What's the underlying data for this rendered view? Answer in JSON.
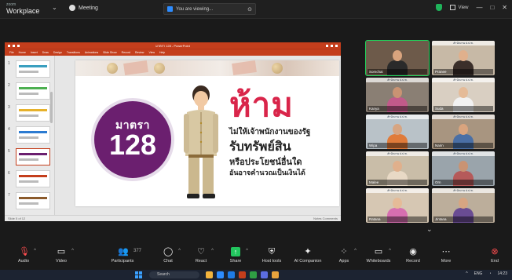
{
  "topbar": {
    "app_name": "Workplace",
    "app_sub": "zoom",
    "meeting_label": "Meeting",
    "share_label": "You are viewing...",
    "view_label": "View"
  },
  "slide": {
    "circle_label": "มาตรา",
    "circle_number": "128",
    "headline": "ห้าม",
    "line1": "ไม่ให้เจ้าพนักงานของรัฐ",
    "line2": "รับทรัพย์สิน",
    "line3": "หรือประโยชน์อื่นใด",
    "line4": "อันอาจคำนวณเป็นเงินได้"
  },
  "ppt": {
    "title": "มาตรา 128 - PowerPoint",
    "ribbon": [
      "File",
      "Home",
      "Insert",
      "Draw",
      "Design",
      "Transitions",
      "Animations",
      "Slide Show",
      "Record",
      "Review",
      "View",
      "Help"
    ],
    "status_left": "Slide 5 of 12",
    "status_right": "Notes   Comments",
    "thumb_numbers": [
      "1",
      "2",
      "3",
      "4",
      "5",
      "6",
      "7"
    ]
  },
  "gallery": {
    "tiles": [
      {
        "name": "Somchai",
        "tag": ""
      },
      {
        "name": "Pranee",
        "tag": "สำนักงาน ป.ป.ช."
      },
      {
        "name": "Kanya",
        "tag": "สำนักงาน ป.ป.ช."
      },
      {
        "name": "Suda",
        "tag": "สำนักงาน ป.ป.ช."
      },
      {
        "name": "Wipa",
        "tag": "สำนักงาน ป.ป.ช."
      },
      {
        "name": "Narin",
        "tag": "สำนักงาน ป.ป.ช."
      },
      {
        "name": "Malee",
        "tag": "สำนักงาน ป.ป.ช."
      },
      {
        "name": "Orn",
        "tag": "สำนักงาน ป.ป.ช."
      },
      {
        "name": "Ratana",
        "tag": "สำนักงาน ป.ป.ช."
      },
      {
        "name": "Jintana",
        "tag": "สำนักงาน ป.ป.ช."
      }
    ]
  },
  "toolbar": {
    "audio": "Audio",
    "video": "Video",
    "participants": "Participants",
    "participants_count": "377",
    "chat": "Chat",
    "react": "React",
    "share": "Share",
    "host_tools": "Host tools",
    "ai_companion": "AI Companion",
    "apps": "Apps",
    "whiteboards": "Whiteboards",
    "record": "Record",
    "more": "More",
    "end": "End"
  },
  "taskbar": {
    "search": "Search",
    "time": "14:23",
    "lang": "ENG"
  },
  "colors": {
    "ppt_accent": "#c43e1c",
    "circle_purple": "#6b1f6f",
    "headline_red": "#d9254a",
    "zoom_share_green": "#22c55e",
    "active_speaker": "#1fd35a"
  }
}
